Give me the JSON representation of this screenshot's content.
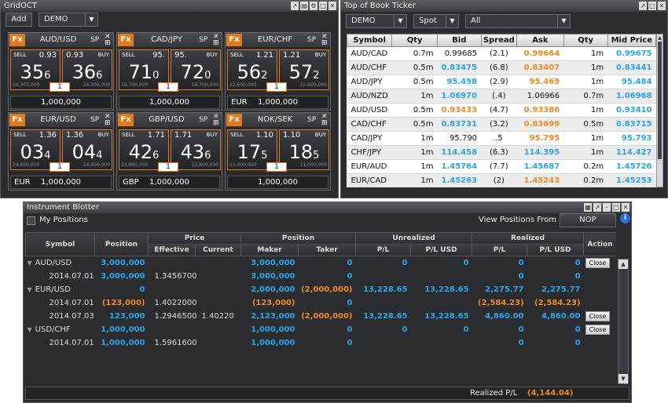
{
  "grid": {
    "title": "GridOCT",
    "add_label": "Add",
    "account": "DEMO",
    "tiles": [
      {
        "pair": "AUD/USD",
        "sp": "SP",
        "sell_label": "SELL",
        "buy_label": "BUY",
        "sell_small": "0.93",
        "buy_small": "0.93",
        "sell_big": "35",
        "sell_pip": "6",
        "buy_big": "36",
        "buy_pip": "6",
        "spread": "1",
        "sell_vol": "24,300,000",
        "buy_vol": "24,300,000",
        "ccy": "",
        "amount": "1,000,000"
      },
      {
        "pair": "CAD/JPY",
        "sp": "SP",
        "sell_label": "SELL",
        "buy_label": "BUY",
        "sell_small": "95.",
        "buy_small": "95.",
        "sell_big": "71",
        "sell_pip": "0",
        "buy_big": "72",
        "buy_pip": "0",
        "spread": "1",
        "sell_vol": "16,700,000",
        "buy_vol": "16,700,000",
        "ccy": "",
        "amount": "1,000,000"
      },
      {
        "pair": "EUR/CHF",
        "sp": "SP",
        "sell_label": "SELL",
        "buy_label": "BUY",
        "sell_small": "1.21",
        "buy_small": "1.21",
        "sell_big": "56",
        "sell_pip": "2",
        "buy_big": "57",
        "buy_pip": "2",
        "spread": "1",
        "sell_vol": "22,600,000",
        "buy_vol": "22,600,000",
        "ccy": "EUR",
        "amount": "1,000,000"
      },
      {
        "pair": "EUR/USD",
        "sp": "SP",
        "sell_label": "SELL",
        "buy_label": "BUY",
        "sell_small": "1.36",
        "buy_small": "1.36",
        "sell_big": "03",
        "sell_pip": "4",
        "buy_big": "04",
        "buy_pip": "4",
        "spread": "1",
        "sell_vol": "24,800,000",
        "buy_vol": "24,800,000",
        "ccy": "EUR",
        "amount": "1,000,000"
      },
      {
        "pair": "GBP/USD",
        "sp": "SP",
        "sell_label": "SELL",
        "buy_label": "BUY",
        "sell_small": "1.71",
        "buy_small": "1.71",
        "sell_big": "42",
        "sell_pip": "6",
        "buy_big": "43",
        "buy_pip": "6",
        "spread": "1",
        "sell_vol": "23,800,000",
        "buy_vol": "23,800,000",
        "ccy": "GBP",
        "amount": "1,000,000"
      },
      {
        "pair": "NOK/SEK",
        "sp": "SP",
        "sell_label": "SELL",
        "buy_label": "BUY",
        "sell_small": "1.10",
        "buy_small": "1.10",
        "sell_big": "17",
        "sell_pip": "5",
        "buy_big": "18",
        "buy_pip": "5",
        "spread": "1",
        "sell_vol": "11,000,000",
        "buy_vol": "11,000,000",
        "ccy": "",
        "amount": "1,000,000"
      }
    ]
  },
  "ticker": {
    "title": "Top of Book Ticker",
    "account": "DEMO",
    "type": "Spot",
    "filter": "All",
    "headers": [
      "Symbol",
      "Qty",
      "Bid",
      "Spread",
      "Ask",
      "Qty",
      "Mid Price"
    ],
    "rows": [
      {
        "symbol": "AUD/CAD",
        "qty1": "0.7m",
        "bid": "0.99685",
        "bid_c": "",
        "spread": "(2.1)",
        "ask": "0.99664",
        "ask_c": "orange",
        "qty2": "1m",
        "mid": "0.99675"
      },
      {
        "symbol": "AUD/CHF",
        "qty1": "0.5m",
        "bid": "0.83475",
        "bid_c": "blue",
        "spread": "(6.8)",
        "ask": "0.83407",
        "ask_c": "orange",
        "qty2": "1m",
        "mid": "0.83441"
      },
      {
        "symbol": "AUD/JPY",
        "qty1": "0.5m",
        "bid": "95.498",
        "bid_c": "blue",
        "spread": "(2.9)",
        "ask": "95.469",
        "ask_c": "orange",
        "qty2": "1m",
        "mid": "95.484"
      },
      {
        "symbol": "AUD/NZD",
        "qty1": "1m",
        "bid": "1.06970",
        "bid_c": "blue",
        "spread": "(.4)",
        "ask": "1.06966",
        "ask_c": "",
        "qty2": "0.7m",
        "mid": "1.06968"
      },
      {
        "symbol": "AUD/USD",
        "qty1": "0.5m",
        "bid": "0.93433",
        "bid_c": "orange",
        "spread": "(4.7)",
        "ask": "0.93386",
        "ask_c": "orange",
        "qty2": "1m",
        "mid": "0.93410"
      },
      {
        "symbol": "CAD/CHF",
        "qty1": "0.5m",
        "bid": "0.83731",
        "bid_c": "blue",
        "spread": "(3.2)",
        "ask": "0.83699",
        "ask_c": "orange",
        "qty2": "0.5m",
        "mid": "0.83715"
      },
      {
        "symbol": "CAD/JPY",
        "qty1": "1m",
        "bid": "95.790",
        "bid_c": "",
        "spread": ".5",
        "ask": "95.795",
        "ask_c": "orange",
        "qty2": "1m",
        "mid": "95.793"
      },
      {
        "symbol": "CHF/JPY",
        "qty1": "1m",
        "bid": "114.458",
        "bid_c": "blue",
        "spread": "(6.3)",
        "ask": "114.395",
        "ask_c": "blue",
        "qty2": "1m",
        "mid": "114.427"
      },
      {
        "symbol": "EUR/AUD",
        "qty1": "1m",
        "bid": "1.45764",
        "bid_c": "blue",
        "spread": "(7.7)",
        "ask": "1.45687",
        "ask_c": "blue",
        "qty2": "0.2m",
        "mid": "1.45726"
      },
      {
        "symbol": "EUR/CAD",
        "qty1": "1m",
        "bid": "1.45263",
        "bid_c": "blue",
        "spread": "(2)",
        "ask": "1.45243",
        "ask_c": "orange",
        "qty2": "0.2m",
        "mid": "1.45253"
      }
    ]
  },
  "blotter": {
    "title": "Instrument Blotter",
    "my_positions": "My Positions",
    "view_from_label": "View Positions From",
    "view_from_value": "NOP",
    "group_headers": {
      "price": "Price",
      "position": "Position",
      "unrealized": "Unrealized",
      "realized": "Realized"
    },
    "headers": {
      "symbol": "Symbol",
      "position": "Position",
      "effective": "Effective",
      "current": "Current",
      "maker": "Maker",
      "taker": "Taker",
      "pl": "P/L",
      "pl_usd": "P/L USD",
      "action": "Action"
    },
    "close_label": "Close",
    "rows": [
      {
        "group": true,
        "symbol": "AUD/USD",
        "position": "3,000,000",
        "pos_c": "b",
        "effective": "",
        "current": "",
        "maker": "3,000,000",
        "maker_c": "b",
        "taker": "0",
        "taker_c": "b",
        "upl": "0",
        "upl_c": "b",
        "upl_usd": "0",
        "upl_usd_c": "b",
        "rpl": "0",
        "rpl_c": "b",
        "rpl_usd": "0",
        "rpl_usd_c": "b",
        "close": true
      },
      {
        "group": false,
        "symbol": "2014.07.01",
        "position": "3,000,000",
        "pos_c": "b",
        "effective": "1.3456700",
        "current": "",
        "maker": "3,000,000",
        "maker_c": "b",
        "taker": "0",
        "taker_c": "b",
        "upl": "",
        "upl_c": "",
        "upl_usd": "",
        "upl_usd_c": "",
        "rpl": "0",
        "rpl_c": "b",
        "rpl_usd": "0",
        "rpl_usd_c": "b",
        "close": false
      },
      {
        "group": true,
        "symbol": "EUR/USD",
        "position": "0",
        "pos_c": "b",
        "effective": "",
        "current": "",
        "maker": "2,000,000",
        "maker_c": "b",
        "taker": "(2,000,000)",
        "taker_c": "o",
        "upl": "13,228.65",
        "upl_c": "b",
        "upl_usd": "13,228.65",
        "upl_usd_c": "b",
        "rpl": "2,275.77",
        "rpl_c": "b",
        "rpl_usd": "2,275.77",
        "rpl_usd_c": "b",
        "close": false
      },
      {
        "group": false,
        "symbol": "2014.07.01",
        "position": "(123,000)",
        "pos_c": "o",
        "effective": "1.4022000",
        "current": "",
        "maker": "(123,000)",
        "maker_c": "o",
        "taker": "0",
        "taker_c": "b",
        "upl": "",
        "upl_c": "",
        "upl_usd": "",
        "upl_usd_c": "",
        "rpl": "(2,584.23)",
        "rpl_c": "o",
        "rpl_usd": "(2,584.23)",
        "rpl_usd_c": "o",
        "close": false
      },
      {
        "group": false,
        "symbol": "2014.07.03",
        "position": "123,000",
        "pos_c": "b",
        "effective": "1.2946500",
        "current": "1.40220",
        "maker": "2,123,000",
        "maker_c": "b",
        "taker": "(2,000,000)",
        "taker_c": "o",
        "upl": "13,228.65",
        "upl_c": "b",
        "upl_usd": "13,228.65",
        "upl_usd_c": "b",
        "rpl": "4,860.00",
        "rpl_c": "b",
        "rpl_usd": "4,860.00",
        "rpl_usd_c": "b",
        "close": true
      },
      {
        "group": true,
        "symbol": "USD/CHF",
        "position": "1,000,000",
        "pos_c": "b",
        "effective": "",
        "current": "",
        "maker": "1,000,000",
        "maker_c": "b",
        "taker": "0",
        "taker_c": "b",
        "upl": "0",
        "upl_c": "b",
        "upl_usd": "0",
        "upl_usd_c": "b",
        "rpl": "0",
        "rpl_c": "b",
        "rpl_usd": "0",
        "rpl_usd_c": "b",
        "close": true
      },
      {
        "group": false,
        "symbol": "2014.07.01",
        "position": "1,000,000",
        "pos_c": "b",
        "effective": "1.5961600",
        "current": "",
        "maker": "1,000,000",
        "maker_c": "b",
        "taker": "0",
        "taker_c": "b",
        "upl": "",
        "upl_c": "",
        "upl_usd": "",
        "upl_usd_c": "",
        "rpl": "0",
        "rpl_c": "b",
        "rpl_usd": "0",
        "rpl_usd_c": "b",
        "close": false
      }
    ],
    "realized_label": "Realized P/L",
    "realized_value": "(4,144.04)"
  },
  "colors": {
    "accent": "#e07a1b",
    "positive": "#2aa6e8",
    "negative": "#f08a24",
    "panel": "#2b2c30"
  }
}
